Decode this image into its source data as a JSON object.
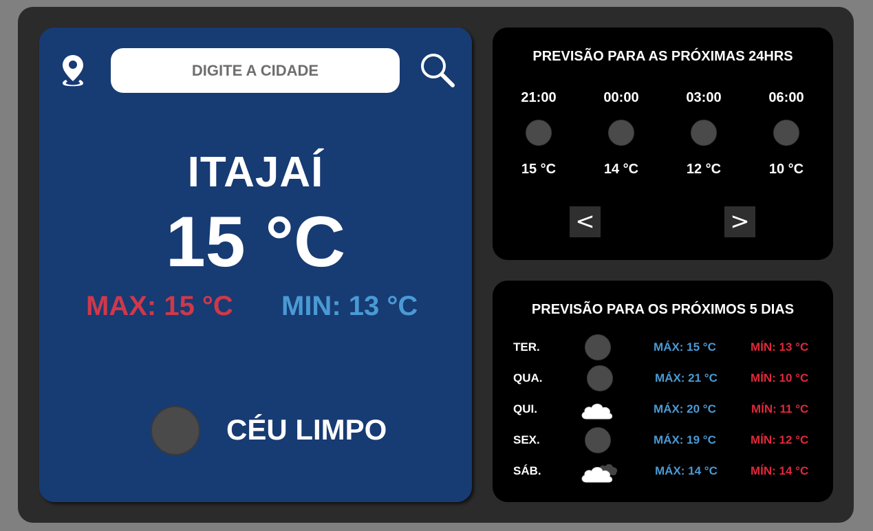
{
  "search": {
    "placeholder": "DIGITE A CIDADE"
  },
  "current": {
    "city": "ITAJAÍ",
    "temp": "15 °C",
    "max": "MAX: 15 °C",
    "min": "MIN: 13 °C",
    "condition": "CÉU LIMPO"
  },
  "hourly": {
    "title": "PREVISÃO PARA AS PRÓXIMAS 24HRS",
    "items": [
      {
        "time": "21:00",
        "temp": "15 °C"
      },
      {
        "time": "00:00",
        "temp": "14 °C"
      },
      {
        "time": "03:00",
        "temp": "12 °C"
      },
      {
        "time": "06:00",
        "temp": "10 °C"
      }
    ],
    "prev_label": "<",
    "next_label": ">"
  },
  "daily": {
    "title": "PREVISÃO PARA OS PRÓXIMOS 5 DIAS",
    "days": [
      {
        "day": "TER.",
        "icon": "circle-icon",
        "max": "MÁX: 15 °C",
        "min": "MÍN: 13 °C"
      },
      {
        "day": "QUA.",
        "icon": "circle-icon",
        "max": "MÁX: 21 °C",
        "min": "MÍN: 10 °C"
      },
      {
        "day": "QUI.",
        "icon": "cloud-icon",
        "max": "MÁX: 20 °C",
        "min": "MÍN: 11 °C"
      },
      {
        "day": "SEX.",
        "icon": "circle-icon",
        "max": "MÁX: 19 °C",
        "min": "MÍN: 12 °C"
      },
      {
        "day": "SÁB.",
        "icon": "cloud-dark-icon",
        "max": "MÁX: 14 °C",
        "min": "MÍN: 14 °C"
      }
    ]
  },
  "colors": {
    "main_card": "#173b73",
    "max_red": "#d0384a",
    "min_blue": "#4a9ad4",
    "panel": "#000000",
    "frame": "#2b2b2b"
  }
}
